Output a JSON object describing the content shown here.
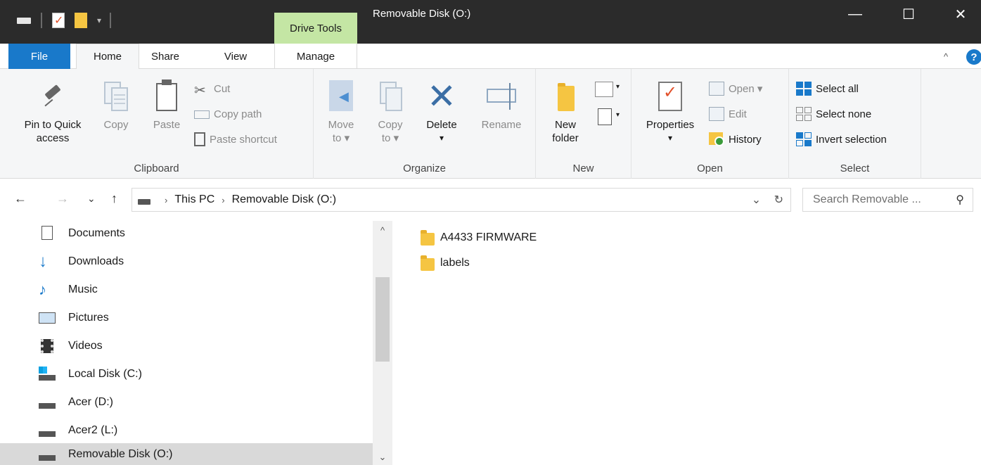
{
  "window": {
    "title": "Removable Disk (O:)",
    "context_tab": "Drive Tools",
    "minimize_glyph": "—",
    "maximize_glyph": "☐",
    "close_glyph": "✕"
  },
  "tabs": {
    "file": "File",
    "home": "Home",
    "share": "Share",
    "view": "View",
    "manage": "Manage",
    "collapse_glyph": "^",
    "help_glyph": "?"
  },
  "ribbon": {
    "clipboard": {
      "label": "Clipboard",
      "pin_line1": "Pin to Quick",
      "pin_line2": "access",
      "copy": "Copy",
      "paste": "Paste",
      "cut": "Cut",
      "copy_path": "Copy path",
      "paste_shortcut": "Paste shortcut"
    },
    "organize": {
      "label": "Organize",
      "move_line1": "Move",
      "move_line2": "to ▾",
      "copy_line1": "Copy",
      "copy_line2": "to ▾",
      "delete": "Delete",
      "delete_caret": "▾",
      "rename": "Rename"
    },
    "new": {
      "label": "New",
      "folder_line1": "New",
      "folder_line2": "folder"
    },
    "open": {
      "label": "Open",
      "properties": "Properties",
      "properties_caret": "▾",
      "open": "Open ▾",
      "edit": "Edit",
      "history": "History"
    },
    "select": {
      "label": "Select",
      "select_all": "Select all",
      "select_none": "Select none",
      "invert_selection": "Invert selection"
    }
  },
  "address": {
    "crumbs": [
      "This PC",
      "Removable Disk (O:)"
    ],
    "crumb_separator": "›",
    "dropdown_glyph": "⌄",
    "refresh_glyph": "↻",
    "search_placeholder": "Search Removable ..."
  },
  "nav": {
    "back_glyph": "←",
    "forward_glyph": "→",
    "recent_glyph": "⌄",
    "up_glyph": "↑",
    "items": [
      {
        "label": "Documents",
        "icon": "documents-icon"
      },
      {
        "label": "Downloads",
        "icon": "downloads-icon"
      },
      {
        "label": "Music",
        "icon": "music-icon"
      },
      {
        "label": "Pictures",
        "icon": "pictures-icon"
      },
      {
        "label": "Videos",
        "icon": "videos-icon"
      },
      {
        "label": "Local Disk (C:)",
        "icon": "local-disk-icon"
      },
      {
        "label": "Acer (D:)",
        "icon": "drive-icon"
      },
      {
        "label": "Acer2 (L:)",
        "icon": "drive-icon"
      },
      {
        "label": "Removable Disk (O:)",
        "icon": "drive-icon",
        "selected": true
      }
    ]
  },
  "files": [
    {
      "name": "A4433 FIRMWARE",
      "icon": "folder-icon"
    },
    {
      "name": "labels",
      "icon": "folder-icon"
    }
  ],
  "colors": {
    "titlebar": "#2b2b2b",
    "drive_tools": "#c4e6a4",
    "file_tab": "#1979ca",
    "ribbon_bg": "#f5f6f7",
    "folder": "#f5c542",
    "selected_row": "#d9d9d9"
  }
}
